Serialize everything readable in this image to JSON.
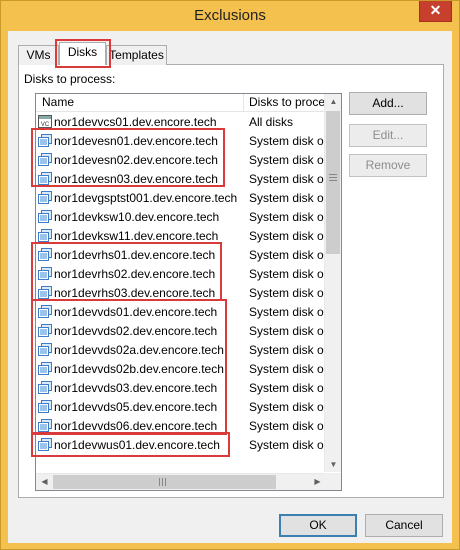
{
  "window": {
    "title": "Exclusions",
    "close_glyph": "✕"
  },
  "tabs": [
    {
      "label": "VMs",
      "active": false
    },
    {
      "label": "Disks",
      "active": true
    },
    {
      "label": "Templates",
      "active": false
    }
  ],
  "section_label": "Disks to process:",
  "list": {
    "columns": [
      "Name",
      "Disks to proce"
    ],
    "rows": [
      {
        "name": "nor1devvcs01.dev.encore.tech",
        "disks": "All disks",
        "icon": "vcenter-icon"
      },
      {
        "name": "nor1devesn01.dev.encore.tech",
        "disks": "System disk only",
        "icon": "vm-icon"
      },
      {
        "name": "nor1devesn02.dev.encore.tech",
        "disks": "System disk only",
        "icon": "vm-icon"
      },
      {
        "name": "nor1devesn03.dev.encore.tech",
        "disks": "System disk only",
        "icon": "vm-icon"
      },
      {
        "name": "nor1devgsptst001.dev.encore.tech",
        "disks": "System disk only",
        "icon": "vm-icon"
      },
      {
        "name": "nor1devksw10.dev.encore.tech",
        "disks": "System disk only",
        "icon": "vm-icon"
      },
      {
        "name": "nor1devksw11.dev.encore.tech",
        "disks": "System disk only",
        "icon": "vm-icon"
      },
      {
        "name": "nor1devrhs01.dev.encore.tech",
        "disks": "System disk only",
        "icon": "vm-icon"
      },
      {
        "name": "nor1devrhs02.dev.encore.tech",
        "disks": "System disk only",
        "icon": "vm-icon"
      },
      {
        "name": "nor1devrhs03.dev.encore.tech",
        "disks": "System disk only",
        "icon": "vm-icon"
      },
      {
        "name": "nor1devvds01.dev.encore.tech",
        "disks": "System disk only",
        "icon": "vm-icon"
      },
      {
        "name": "nor1devvds02.dev.encore.tech",
        "disks": "System disk only",
        "icon": "vm-icon"
      },
      {
        "name": "nor1devvds02a.dev.encore.tech",
        "disks": "System disk only",
        "icon": "vm-icon"
      },
      {
        "name": "nor1devvds02b.dev.encore.tech",
        "disks": "System disk only",
        "icon": "vm-icon"
      },
      {
        "name": "nor1devvds03.dev.encore.tech",
        "disks": "System disk only",
        "icon": "vm-icon"
      },
      {
        "name": "nor1devvds05.dev.encore.tech",
        "disks": "System disk only",
        "icon": "vm-icon"
      },
      {
        "name": "nor1devvds06.dev.encore.tech",
        "disks": "System disk only",
        "icon": "vm-icon"
      },
      {
        "name": "nor1devwus01.dev.encore.tech",
        "disks": "System disk only",
        "icon": "vm-icon"
      }
    ]
  },
  "side_buttons": {
    "add": "Add...",
    "edit": "Edit...",
    "remove": "Remove"
  },
  "footer_buttons": {
    "ok": "OK",
    "cancel": "Cancel"
  },
  "colors": {
    "title_bar": "#f4c04e",
    "close_button": "#c7402e",
    "highlight": "#d93a3a",
    "icon_blue": "#3d7cc9"
  }
}
